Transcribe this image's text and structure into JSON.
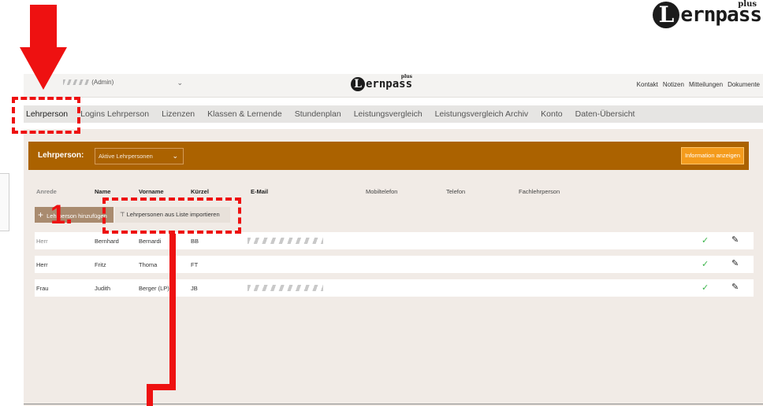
{
  "brand": {
    "logo_letter": "L",
    "logo_rest": "ernpass",
    "logo_plus": "plus"
  },
  "topbar": {
    "user_label": "(Admin)",
    "links": [
      "Kontakt",
      "Notizen",
      "Mitteilungen",
      "Dokumente"
    ]
  },
  "nav": {
    "items": [
      "Lehrperson",
      "Logins Lehrperson",
      "Lizenzen",
      "Klassen & Lernende",
      "Stundenplan",
      "Leistungsvergleich",
      "Leistungsvergleich Archiv",
      "Konto",
      "Daten-Übersicht"
    ]
  },
  "filter": {
    "label": "Lehrperson:",
    "selected": "Aktive Lehrpersonen",
    "info_button": "Information anzeigen"
  },
  "table": {
    "headers": [
      "Anrede",
      "Name",
      "Vorname",
      "Kürzel",
      "E-Mail",
      "Mobiltelefon",
      "Telefon",
      "Fachlehrperson"
    ],
    "add_button": "Lehrperson hinzufügen",
    "import_button": "Lehrpersonen aus Liste importieren",
    "rows": [
      {
        "anrede": "Herr",
        "name": "Bernhard",
        "vorname": "Bernardi",
        "kuerzel": "BB"
      },
      {
        "anrede": "Herr",
        "name": "Fritz",
        "vorname": "Thoma",
        "kuerzel": "FT"
      },
      {
        "anrede": "Frau",
        "name": "Judith",
        "vorname": "Berger (LP)",
        "kuerzel": "JB"
      }
    ]
  },
  "annotation": {
    "step": "1.",
    "color": "#ee1111"
  },
  "colors": {
    "accent": "#ab6200",
    "info": "#f49b1c",
    "check": "#3bb54a"
  }
}
